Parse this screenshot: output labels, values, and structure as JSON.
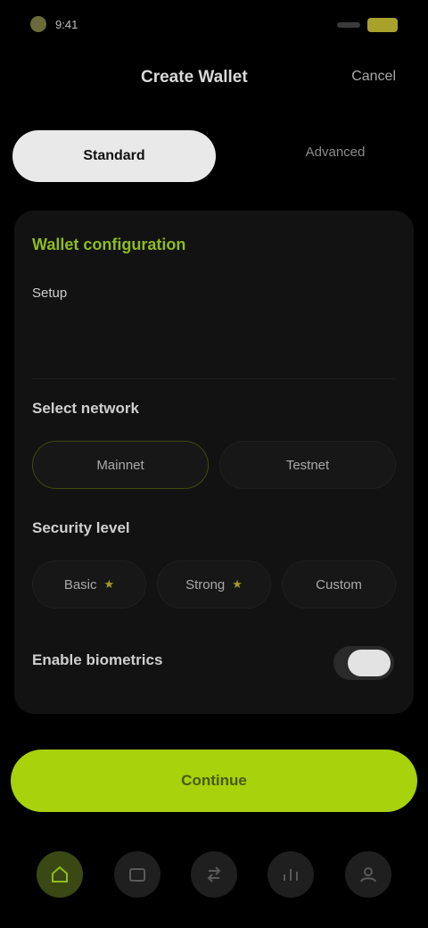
{
  "status": {
    "time": "9:41"
  },
  "header": {
    "title": "Create Wallet",
    "action": "Cancel"
  },
  "segments": {
    "active": "Standard",
    "inactive": "Advanced"
  },
  "card": {
    "section_title": "Wallet configuration",
    "subtitle": "Setup",
    "network_label": "Select network",
    "network_options": [
      "Mainnet",
      "Testnet"
    ],
    "security_label": "Security level",
    "security_options": [
      "Basic",
      "Strong",
      "Custom"
    ],
    "toggle_label": "Enable biometrics",
    "toggle_on": true
  },
  "cta": {
    "label": "Continue"
  },
  "tabs": [
    {
      "icon": "home-icon",
      "active": true
    },
    {
      "icon": "wallet-icon",
      "active": false
    },
    {
      "icon": "swap-icon",
      "active": false
    },
    {
      "icon": "chart-icon",
      "active": false
    },
    {
      "icon": "profile-icon",
      "active": false
    }
  ],
  "colors": {
    "accent": "#A7D20C",
    "background": "#000000",
    "card": "#121212",
    "section_title": "#8FBC1D"
  }
}
